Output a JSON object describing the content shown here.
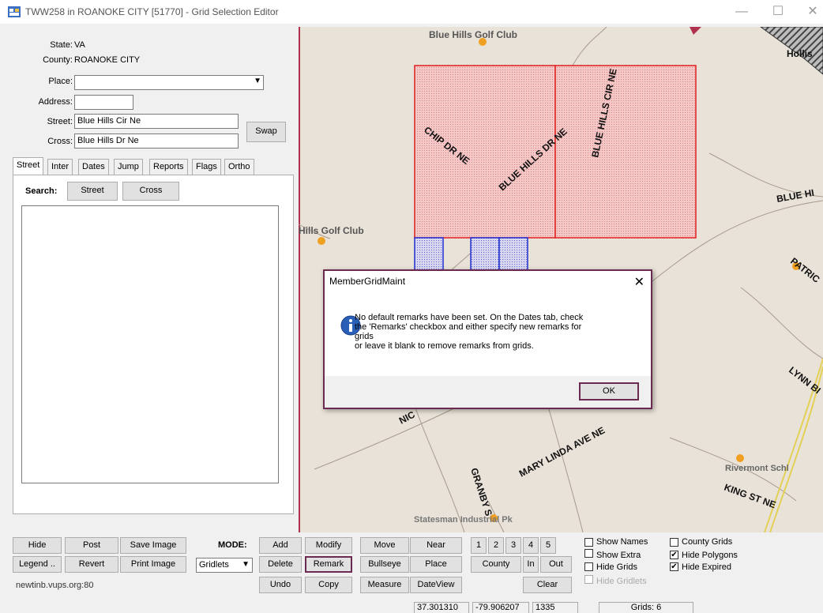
{
  "window": {
    "title": "TWW258 in ROANOKE CITY [51770] - Grid Selection Editor",
    "minimize": "—",
    "maximize": "☐",
    "close": "✕"
  },
  "form": {
    "state_label": "State:",
    "state_value": "VA",
    "county_label": "County:",
    "county_value": "ROANOKE CITY",
    "place_label": "Place:",
    "place_value": "",
    "address_label": "Address:",
    "address_value": "",
    "street_label": "Street:",
    "street_value": "Blue Hills Cir Ne",
    "cross_label": "Cross:",
    "cross_value": "Blue Hills Dr Ne",
    "swap_label": "Swap"
  },
  "tabs": [
    "Street",
    "Inter",
    "Dates",
    "Jump",
    "Reports",
    "Flags",
    "Ortho"
  ],
  "search": {
    "label": "Search:",
    "street_btn": "Street",
    "cross_btn": "Cross"
  },
  "map_labels": {
    "golf_top": "Blue Hills Golf Club",
    "golf_left": "Hills Golf Club",
    "chip": "CHIP DR NE",
    "blue_hills_dr": "BLUE HILLS DR NE",
    "blue_hills_cir": "BLUE HILLS CIR NE",
    "blue_hi": "BLUE HI",
    "patric": "PATRIC",
    "lynn": "LYNN BI",
    "rivermont": "Rivermont Schl",
    "king": "KING ST NE",
    "mary_linda": "MARY LINDA AVE NE",
    "granby": "GRANBY S",
    "nic": "NIC",
    "statesman": "Statesman Industrial Pk",
    "holli": "Hollis"
  },
  "dialog": {
    "title": "MemberGridMaint",
    "close": "✕",
    "lines": [
      "No default remarks have been set.  On the Dates tab, check",
      "the 'Remarks' checkbox and either specify new remarks for",
      "grids",
      "or leave it blank to remove remarks from grids."
    ],
    "ok": "OK"
  },
  "toolbar": {
    "hide": "Hide",
    "post": "Post",
    "save_image": "Save Image",
    "legend": "Legend ..",
    "revert": "Revert",
    "print_image": "Print Image",
    "mode_label": "MODE:",
    "mode_value": "Gridlets",
    "add": "Add",
    "modify": "Modify",
    "delete": "Delete",
    "remark": "Remark",
    "undo": "Undo",
    "copy": "Copy",
    "move": "Move",
    "near": "Near",
    "bullseye": "Bullseye",
    "place": "Place",
    "measure": "Measure",
    "dateview": "DateView",
    "n1": "1",
    "n2": "2",
    "n3": "3",
    "n4": "4",
    "n5": "5",
    "county": "County",
    "in": "In",
    "out": "Out",
    "clear": "Clear",
    "server": "newtinb.vups.org:80"
  },
  "checkboxes": {
    "show_names": {
      "label": "Show Names",
      "checked": false
    },
    "show_extra": {
      "label": "Show Extra",
      "checked": false
    },
    "hide_grids": {
      "label": "Hide Grids",
      "checked": false
    },
    "hide_gridlets": {
      "label": "Hide Gridlets",
      "checked": false
    },
    "county_grids": {
      "label": "County Grids",
      "checked": false
    },
    "hide_polygons": {
      "label": "Hide Polygons",
      "checked": true
    },
    "hide_expired": {
      "label": "Hide Expired",
      "checked": true
    }
  },
  "status": {
    "lat": "37.301310",
    "lon": "-79.906207",
    "zoom": "1335",
    "grids": "Grids: 6"
  },
  "colors": {
    "accent": "#6b2a4f",
    "grid_red": "#e02020",
    "grid_blue": "#1f2fd0",
    "poi_orange": "#f0a020"
  }
}
